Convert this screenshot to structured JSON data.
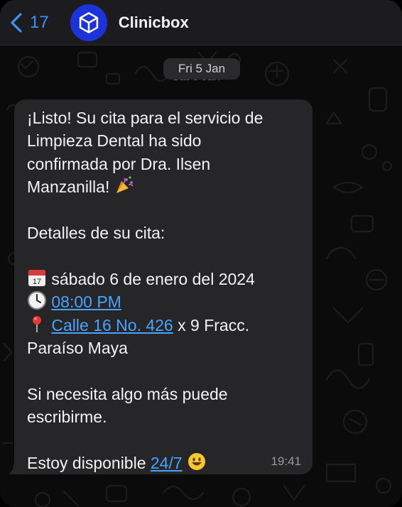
{
  "header": {
    "back_count": "17",
    "contact_name": "Clinicbox"
  },
  "date_chip": {
    "label": "Fri 5 Jan",
    "ghost_label": "Sat 6 Jan"
  },
  "message": {
    "line1": "¡Listo!  Su cita para el servicio de",
    "line2": "Limpieza Dental ha sido",
    "line3": "confirmada por Dra. Ilsen",
    "line4": "Manzanilla!",
    "details_heading": "Detalles de su cita:",
    "date_text": "sábado 6 de enero del 2024",
    "time_link": "08:00 PM",
    "address_link": "Calle 16 No. 426",
    "address_rest": "x 9 Fracc.",
    "address_line2": "Paraíso Maya",
    "help_line1": "Si necesita algo más puede",
    "help_line2": "escribirme.",
    "available_text": "Estoy disponible",
    "available_link": "24/7",
    "timestamp": "19:41"
  },
  "icons": [
    "chevron-left-icon",
    "cube-logo-icon",
    "party-popper-icon",
    "calendar-icon",
    "clock-icon",
    "pin-icon",
    "smiley-icon"
  ],
  "colors": {
    "accent": "#3b93f7",
    "link": "#4aa3ff",
    "avatar_bg": "#1b33d8",
    "bubble_bg": "#262628",
    "header_bg": "#1c1c1e"
  }
}
